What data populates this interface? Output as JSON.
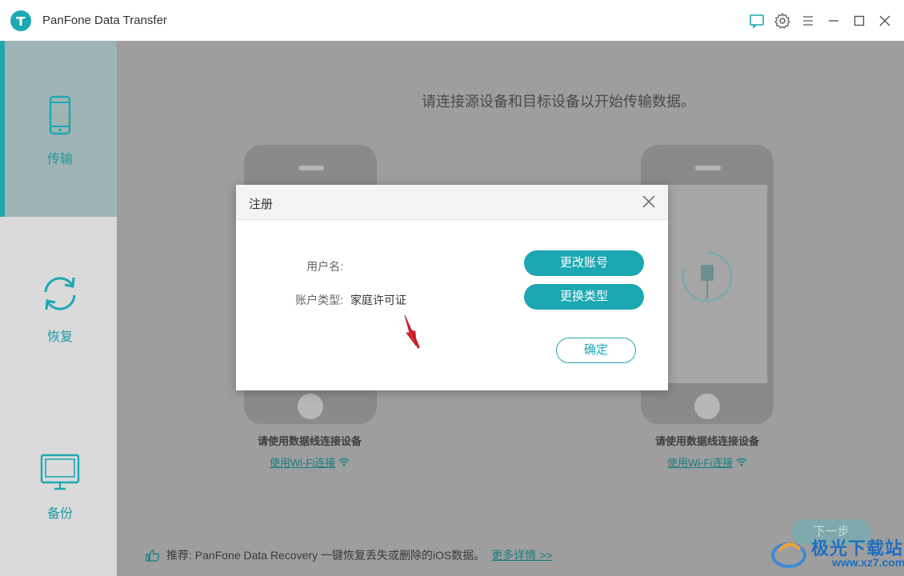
{
  "app": {
    "title": "PanFone Data Transfer",
    "accent_color": "#1ca8b3"
  },
  "titlebar_icons": [
    "feedback-icon",
    "gear-icon",
    "menu-icon",
    "minimize-icon",
    "maximize-icon",
    "close-icon"
  ],
  "sidebar": {
    "items": [
      {
        "label": "传输",
        "icon": "phone-icon",
        "active": true
      },
      {
        "label": "恢复",
        "icon": "refresh-icon",
        "active": false
      },
      {
        "label": "备份",
        "icon": "monitor-icon",
        "active": false
      }
    ]
  },
  "main": {
    "headline": "请连接源设备和目标设备以开始传输数据。",
    "left_device": {
      "caption": "请使用数据线连接设备",
      "wifi_link": "使用Wi-Fi连接"
    },
    "right_device": {
      "caption": "请使用数据线连接设备",
      "wifi_link": "使用Wi-Fi连接"
    },
    "next_button": "下一步",
    "footer": {
      "text": "推荐: PanFone Data Recovery 一键恢复丢失或删除的iOS数据。",
      "more_link": "更多详情 >>"
    }
  },
  "dialog": {
    "title": "注册",
    "username_label": "用户名:",
    "username_value": "",
    "account_type_label": "账户类型:",
    "account_type_value": "家庭许可证",
    "change_account_button": "更改账号",
    "change_type_button": "更换类型",
    "ok_button": "确定"
  },
  "watermark": {
    "text": "极光下载站",
    "url": "www.xz7.com"
  }
}
